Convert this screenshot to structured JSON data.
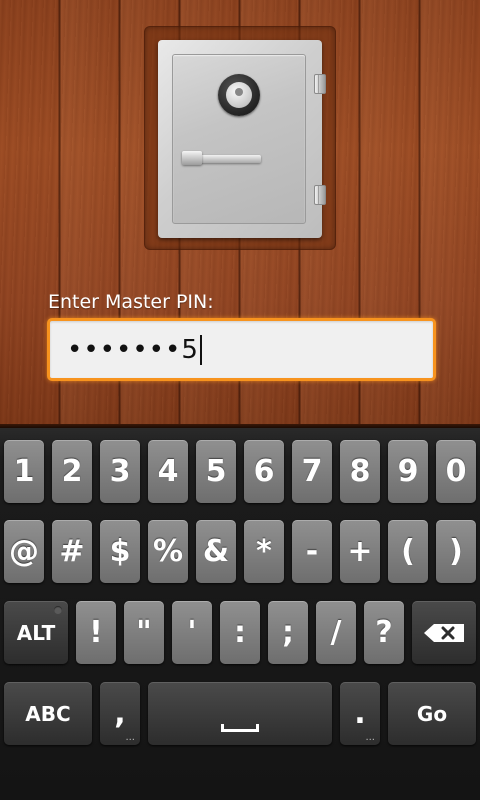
{
  "pin": {
    "label": "Enter Master PIN:",
    "masked_value": "•••••••",
    "last_char": "5"
  },
  "keyboard": {
    "row1": [
      "1",
      "2",
      "3",
      "4",
      "5",
      "6",
      "7",
      "8",
      "9",
      "0"
    ],
    "row2": [
      "@",
      "#",
      "$",
      "%",
      "&",
      "*",
      "-",
      "+",
      "(",
      ")"
    ],
    "row3": {
      "alt_label": "ALT",
      "symbols": [
        "!",
        "\"",
        "'",
        ":",
        ";",
        "/",
        "?"
      ]
    },
    "row4": {
      "abc_label": "ABC",
      "comma": ",",
      "comma_more": "...",
      "period": ".",
      "period_more": "...",
      "go_label": "Go"
    }
  },
  "colors": {
    "focus_border": "#f7931e",
    "wood": "#9b4a22"
  },
  "icons": {
    "backspace": "backspace-icon",
    "space": "space-bar-icon",
    "safe": "safe-icon"
  }
}
